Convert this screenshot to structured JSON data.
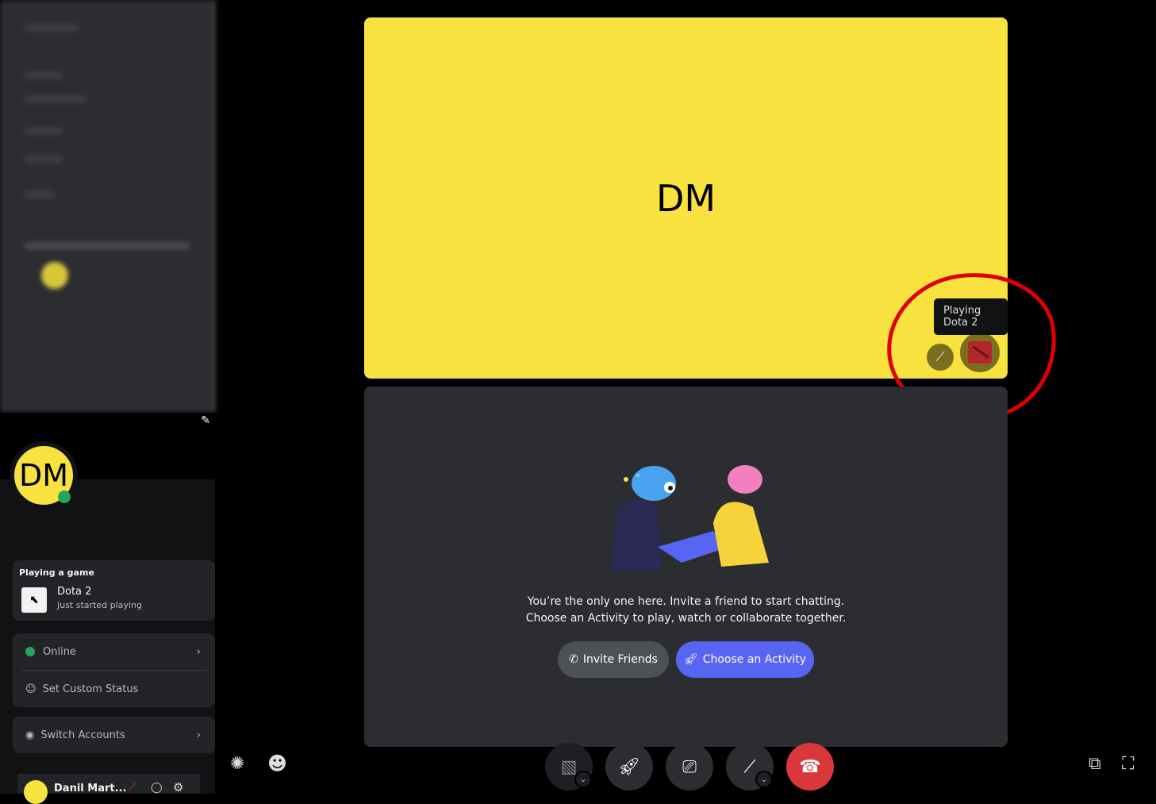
{
  "tile_main": {
    "initials": "DM",
    "tooltip": "Playing Dota 2",
    "game_icon": "dota2-icon",
    "mute_icon": "mic-off-icon"
  },
  "empty": {
    "line1": "You’re the only one here. Invite a friend to start chatting.",
    "line2": "Choose an Activity to play, watch or collaborate together.",
    "invite": "Invite Friends",
    "activity": "Choose an Activity"
  },
  "profile": {
    "initials": "DM",
    "activity_header": "Playing a game",
    "game": "Dota 2",
    "game_status": "Just started playing",
    "status": "Online",
    "custom_status": "Set Custom Status",
    "switch": "Switch Accounts",
    "username": "Danil Mart..."
  },
  "colors": {
    "accent": "#5865f2",
    "yellow": "#f7e23f",
    "online": "#23a55a",
    "hangup": "#da373c",
    "annotation": "#e00000"
  }
}
